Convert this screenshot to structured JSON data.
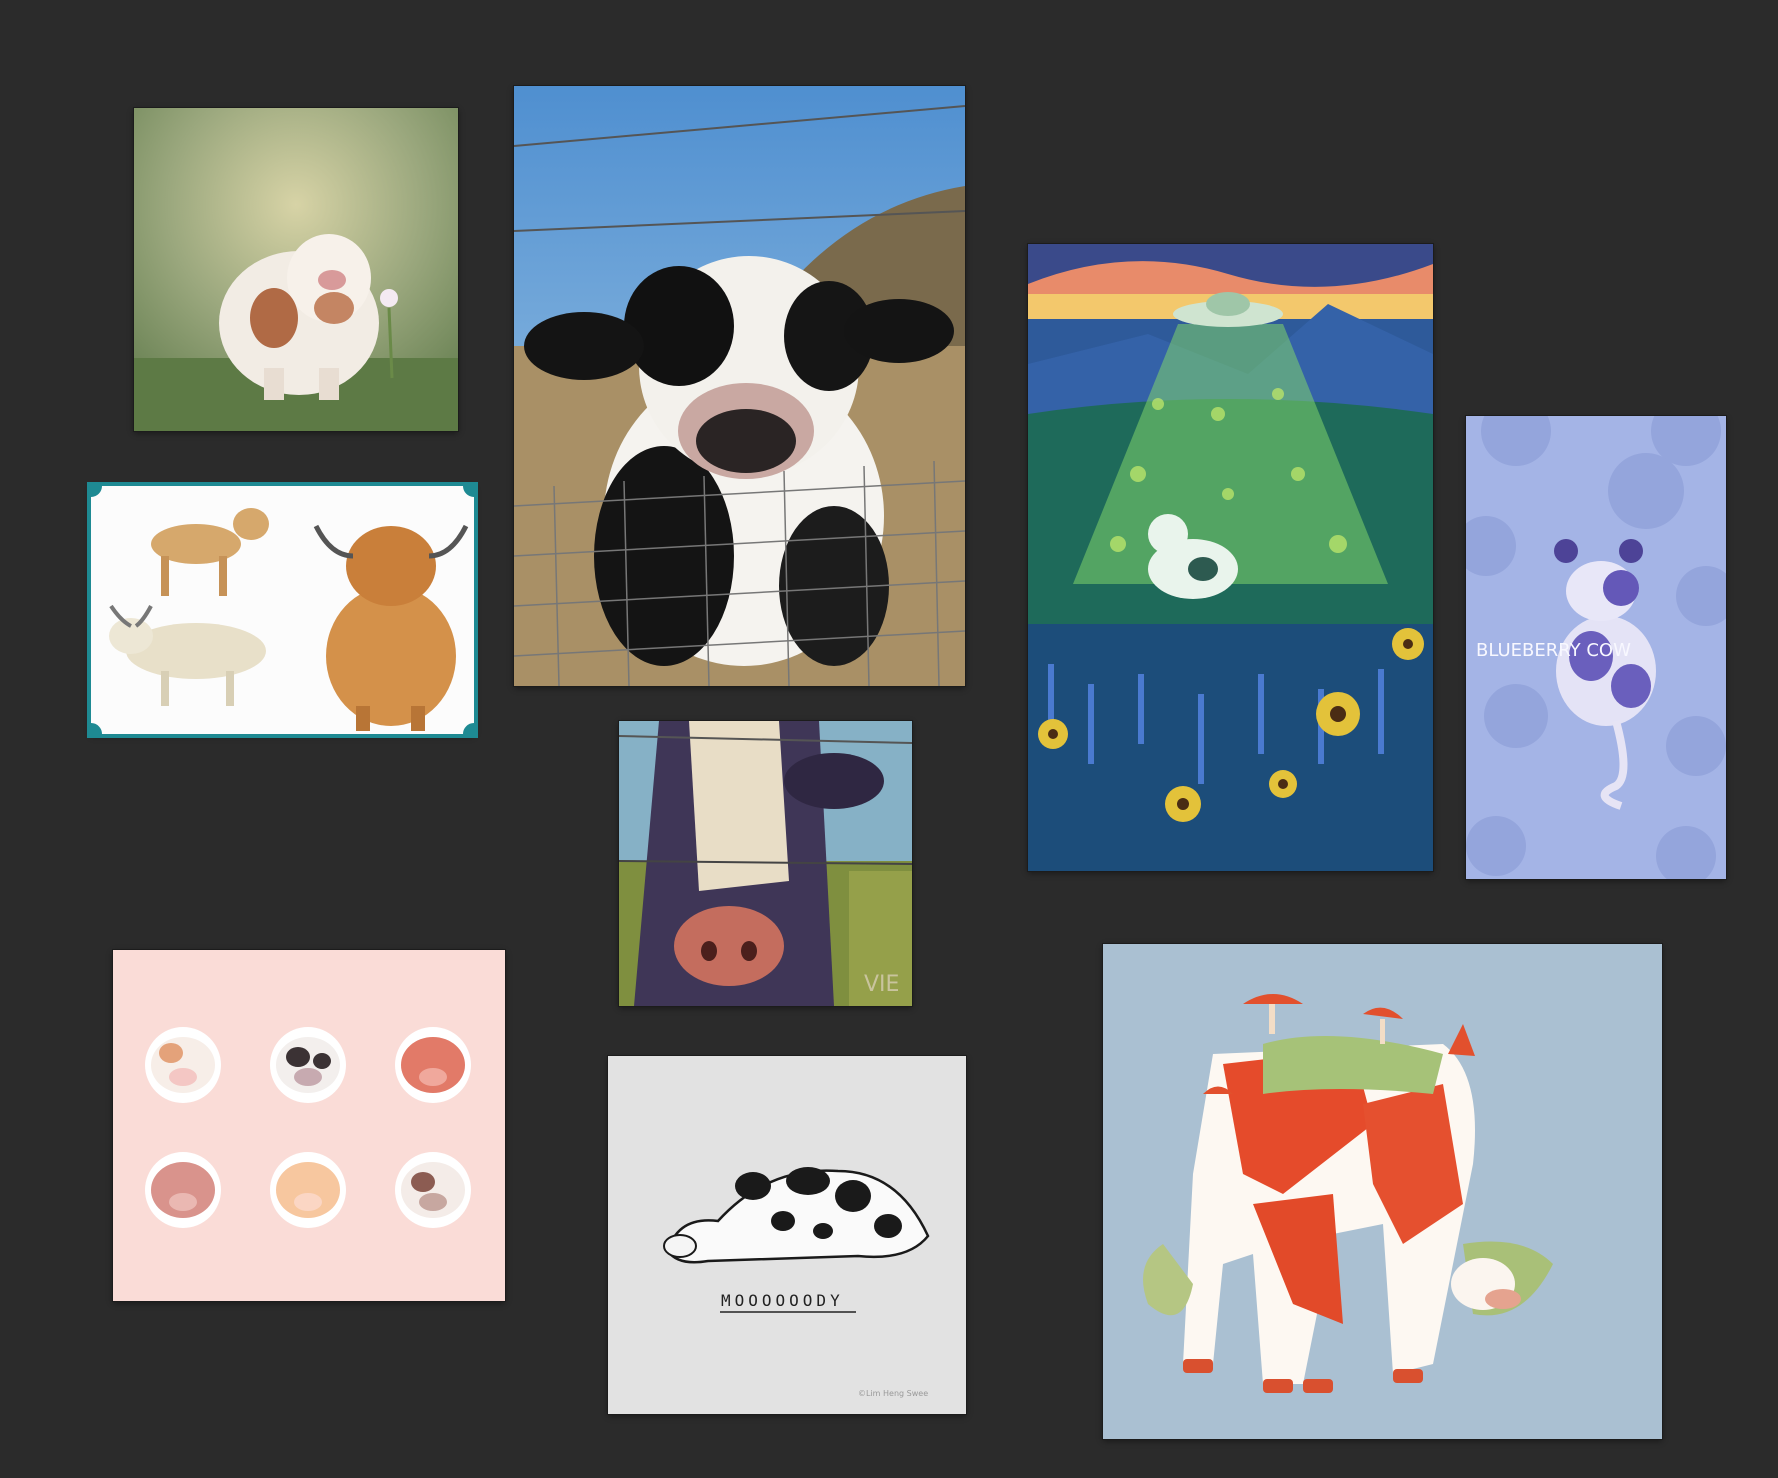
{
  "canvas": {
    "background": "#2b2b2b",
    "selection_color": "#1e8a93"
  },
  "cards": [
    {
      "id": "fluffy-calf-photo",
      "subject": "Fluffy white and brown calf in grass"
    },
    {
      "id": "highland-cow-sketches",
      "subject": "Sketches of highland cattle",
      "selected": true
    },
    {
      "id": "calf-fence-photo",
      "subject": "Black and white calf nose at fence"
    },
    {
      "id": "cow-painting",
      "subject": "Painted cow behind barbed wire",
      "signature": "VIE"
    },
    {
      "id": "ufo-cow-illustration",
      "subject": "UFO abducting cow over flower field"
    },
    {
      "id": "blueberry-cow-illustration",
      "subject": "Blueberry cow",
      "text": "BLUEBERRY COW"
    },
    {
      "id": "chibi-cows-stickers",
      "subject": "Six chibi cow stickers"
    },
    {
      "id": "mooody-cow-doodle",
      "subject": "Lying cow doodle",
      "text": "MOOOOOODY",
      "credit": "©Lim Heng Swee"
    },
    {
      "id": "mushroom-cow-illustration",
      "subject": "Cow covered in mushrooms and moss"
    }
  ]
}
